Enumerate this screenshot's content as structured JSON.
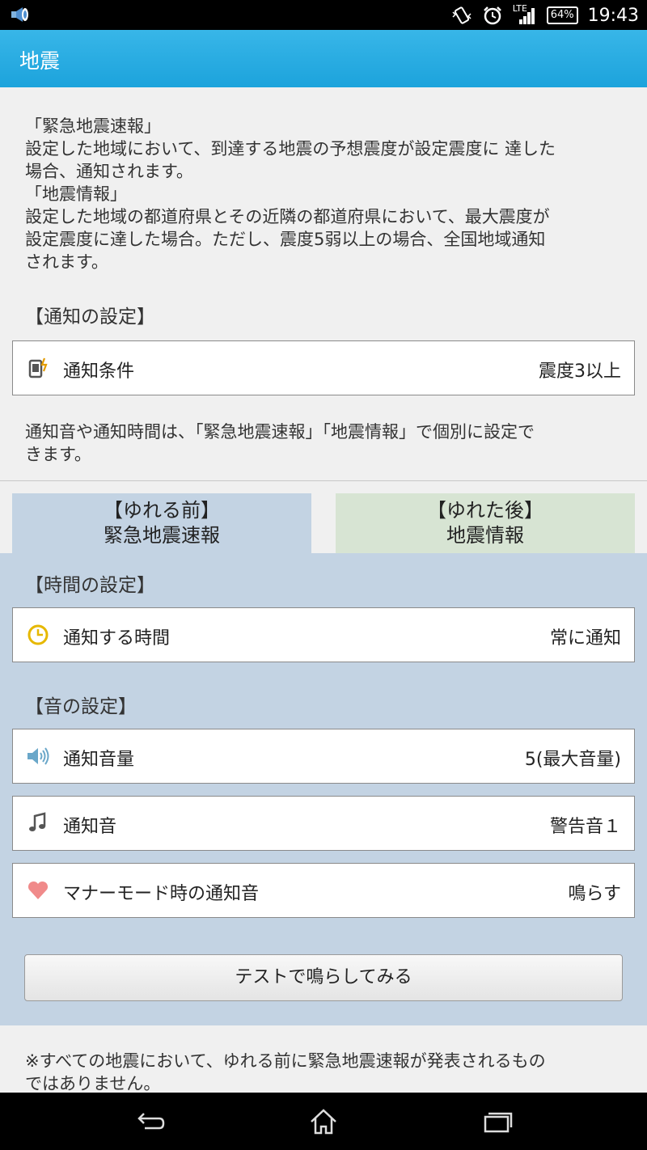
{
  "status_bar": {
    "time": "19:43",
    "network": "LTE",
    "battery": "64%",
    "icons": [
      "notification-speaker-icon",
      "vibrate-icon",
      "alarm-icon",
      "signal-icon",
      "battery-icon"
    ]
  },
  "app_bar": {
    "title": "地震"
  },
  "intro": {
    "lines": [
      "「緊急地震速報」",
      "設定した地域において、到達する地震の予想震度が設定震度に 達した",
      "場合、通知されます。",
      "「地震情報」",
      "設定した地域の都道府県とその近隣の都道府県において、最大震度が",
      "設定震度に達した場合。ただし、震度5弱以上の場合、全国地域通知",
      "されます。"
    ]
  },
  "notification_settings": {
    "heading": "【通知の設定】",
    "condition": {
      "label": "通知条件",
      "value": "震度3以上",
      "icon": "phone-alert-icon"
    }
  },
  "note": {
    "lines": [
      "通知音や通知時間は、「緊急地震速報」「地震情報」で個別に設定で",
      "きます。"
    ]
  },
  "tabs": {
    "before": {
      "line1": "【ゆれる前】",
      "line2": "緊急地震速報",
      "color": "#c3d3e3"
    },
    "after": {
      "line1": "【ゆれた後】",
      "line2": "地震情報",
      "color": "#d7e4d3"
    }
  },
  "time_settings": {
    "heading": "【時間の設定】",
    "notify_time": {
      "label": "通知する時間",
      "value": "常に通知",
      "icon": "clock-icon"
    }
  },
  "sound_settings": {
    "heading": "【音の設定】",
    "volume": {
      "label": "通知音量",
      "value": "5(最大音量)",
      "icon": "speaker-icon"
    },
    "sound": {
      "label": "通知音",
      "value": "警告音１",
      "icon": "music-note-icon"
    },
    "manner": {
      "label": "マナーモード時の通知音",
      "value": "鳴らす",
      "icon": "heart-icon"
    }
  },
  "test_button": {
    "label": "テストで鳴らしてみる"
  },
  "footnote": {
    "lines": [
      "※すべての地震において、ゆれる前に緊急地震速報が発表されるもの",
      "ではありません。"
    ]
  },
  "nav_bar": {
    "icons": [
      "back-icon",
      "home-icon",
      "recent-apps-icon"
    ]
  },
  "colors": {
    "accent": "#1ca3dc",
    "clock": "#e6b800",
    "heart": "#f08a8a",
    "speaker": "#6aa7c9"
  }
}
